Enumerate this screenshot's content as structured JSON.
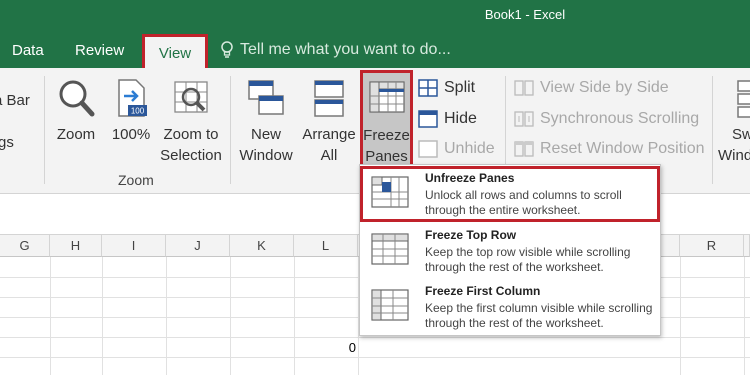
{
  "window": {
    "title": "Book1 - Excel"
  },
  "tabs": {
    "data": "Data",
    "review": "Review",
    "view": "View"
  },
  "tellme": {
    "placeholder": "Tell me what you want to do..."
  },
  "ribbon": {
    "partial_formula_bar": "a Bar",
    "partial_gs": "gs",
    "zoom": "Zoom",
    "zoom100": "100%",
    "zoom_to": "Zoom to",
    "selection": "Selection",
    "new": "New",
    "window": "Window",
    "arrange": "Arrange",
    "all": "All",
    "freeze": "Freeze",
    "panes": "Panes",
    "split": "Split",
    "hide": "Hide",
    "unhide": "Unhide",
    "view_side_by_side": "View Side by Side",
    "synchronous_scrolling": "Synchronous Scrolling",
    "reset_window_position": "Reset Window Position",
    "partial_sw": "Sw",
    "partial_wind": "Wind",
    "zoom_group": "Zoom",
    "zoom_badge": "100"
  },
  "columns": [
    "G",
    "H",
    "I",
    "J",
    "K",
    "L",
    "R"
  ],
  "cell": {
    "value": "0"
  },
  "menu": {
    "items": [
      {
        "title": "Unfreeze Panes",
        "desc": "Unlock all rows and columns to scroll through the entire worksheet."
      },
      {
        "title": "Freeze Top Row",
        "desc": "Keep the top row visible while scrolling through the rest of the worksheet."
      },
      {
        "title": "Freeze First Column",
        "desc": "Keep the first column visible while scrolling through the rest of the worksheet."
      }
    ]
  },
  "colors": {
    "excel_green": "#217346",
    "highlight_red": "#c0222b"
  }
}
